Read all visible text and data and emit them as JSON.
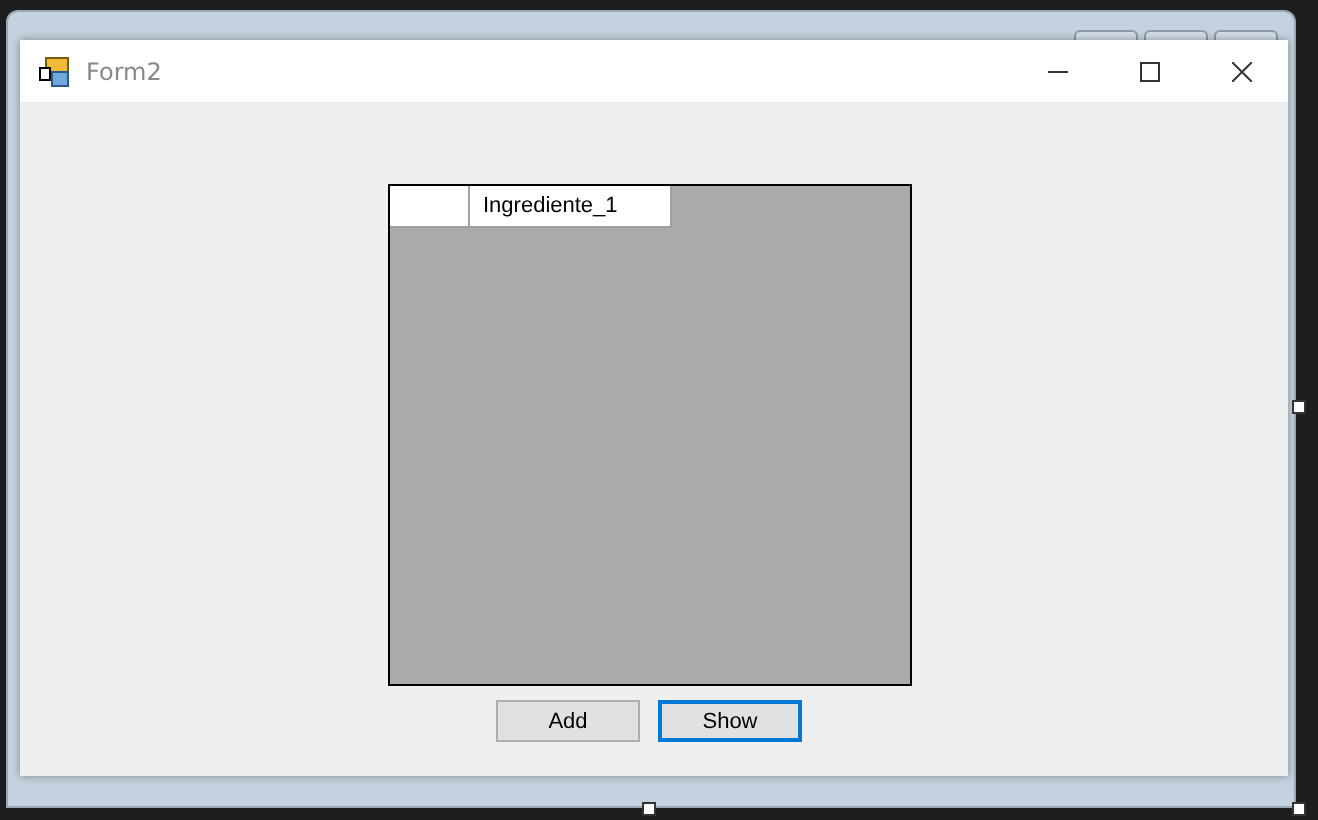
{
  "window": {
    "title": "Form2"
  },
  "grid": {
    "rows": [
      {
        "cells": [
          "Ingrediente_1"
        ]
      }
    ]
  },
  "buttons": [
    {
      "label": "Add",
      "focused": false
    },
    {
      "label": "Show",
      "focused": true
    }
  ]
}
